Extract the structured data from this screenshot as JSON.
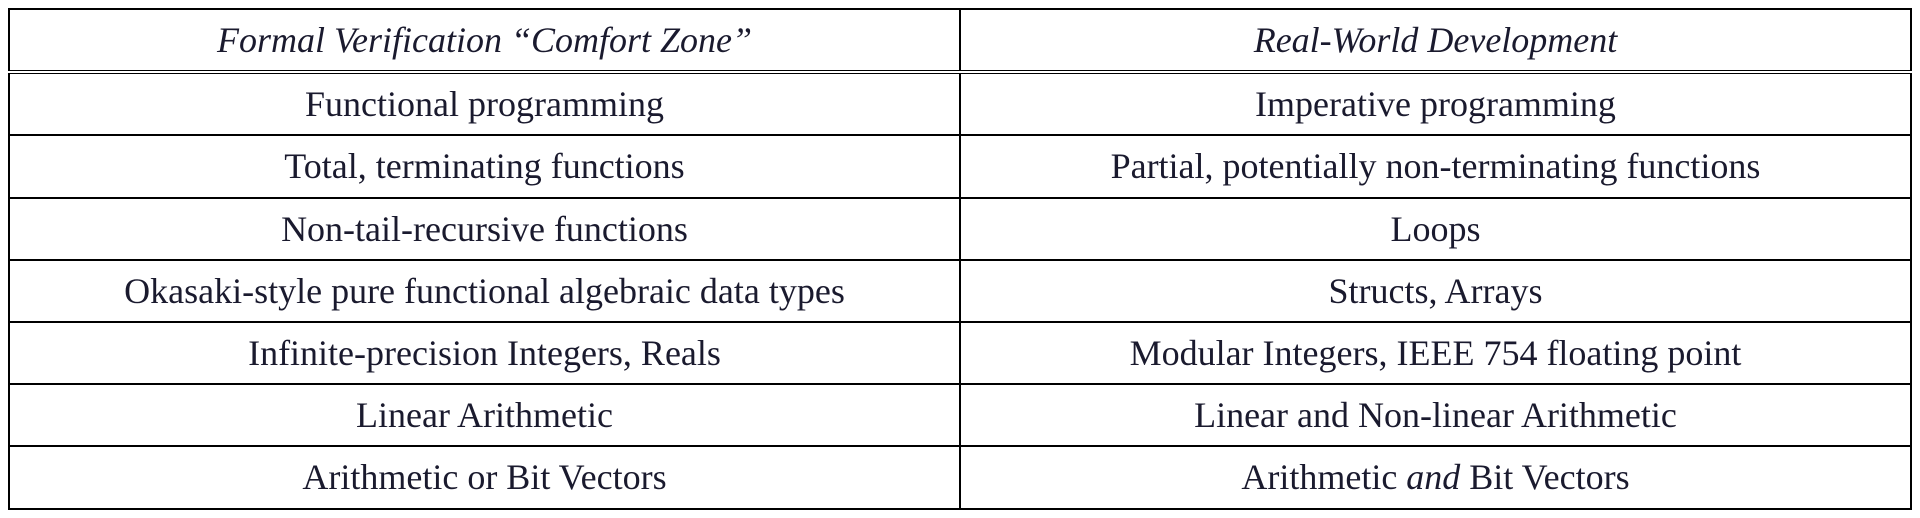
{
  "table": {
    "headers": {
      "left": "Formal Verification “Comfort Zone”",
      "right": "Real-World Development"
    },
    "rows": [
      {
        "left": "Functional programming",
        "right": "Imperative programming"
      },
      {
        "left": "Total, terminating functions",
        "right": "Partial, potentially non-terminating functions"
      },
      {
        "left": "Non-tail-recursive functions",
        "right": "Loops"
      },
      {
        "left": "Okasaki-style pure functional algebraic data types",
        "right": "Structs, Arrays"
      },
      {
        "left": "Infinite-precision Integers, Reals",
        "right": "Modular Integers, IEEE 754 floating point"
      },
      {
        "left": "Linear Arithmetic",
        "right": "Linear and Non-linear Arithmetic"
      },
      {
        "left": "Arithmetic or Bit Vectors",
        "right_pre": "Arithmetic ",
        "right_em": "and",
        "right_post": " Bit Vectors"
      }
    ]
  },
  "chart_data": {
    "type": "table",
    "columns": [
      "Formal Verification “Comfort Zone”",
      "Real-World Development"
    ],
    "rows": [
      [
        "Functional programming",
        "Imperative programming"
      ],
      [
        "Total, terminating functions",
        "Partial, potentially non-terminating functions"
      ],
      [
        "Non-tail-recursive functions",
        "Loops"
      ],
      [
        "Okasaki-style pure functional algebraic data types",
        "Structs, Arrays"
      ],
      [
        "Infinite-precision Integers, Reals",
        "Modular Integers, IEEE 754 floating point"
      ],
      [
        "Linear Arithmetic",
        "Linear and Non-linear Arithmetic"
      ],
      [
        "Arithmetic or Bit Vectors",
        "Arithmetic and Bit Vectors"
      ]
    ]
  }
}
